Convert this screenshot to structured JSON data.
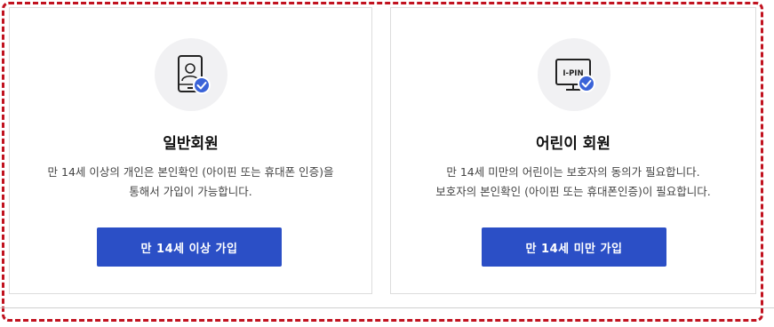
{
  "cards": [
    {
      "icon": "mobile-phone-person-verified-icon",
      "title": "일반회원",
      "desc_line1": "만 14세 이상의 개인은 본인확인 (아이핀 또는 휴대폰 인증)을",
      "desc_line2": "통해서 가입이 가능합니다.",
      "button_label": "만 14세 이상 가입"
    },
    {
      "icon": "ipin-monitor-verified-icon",
      "icon_text": "I-PIN",
      "title": "어린이 회원",
      "desc_line1": "만 14세 미만의 어린이는 보호자의 동의가 필요합니다.",
      "desc_line2": "보호자의 본인확인 (아이핀 또는 휴대폰인증)이 필요합니다.",
      "button_label": "만 14세 미만 가입"
    }
  ],
  "colors": {
    "button": "#2b4fc6",
    "check_badge": "#3a63d8",
    "highlight_border": "#c1121f"
  }
}
